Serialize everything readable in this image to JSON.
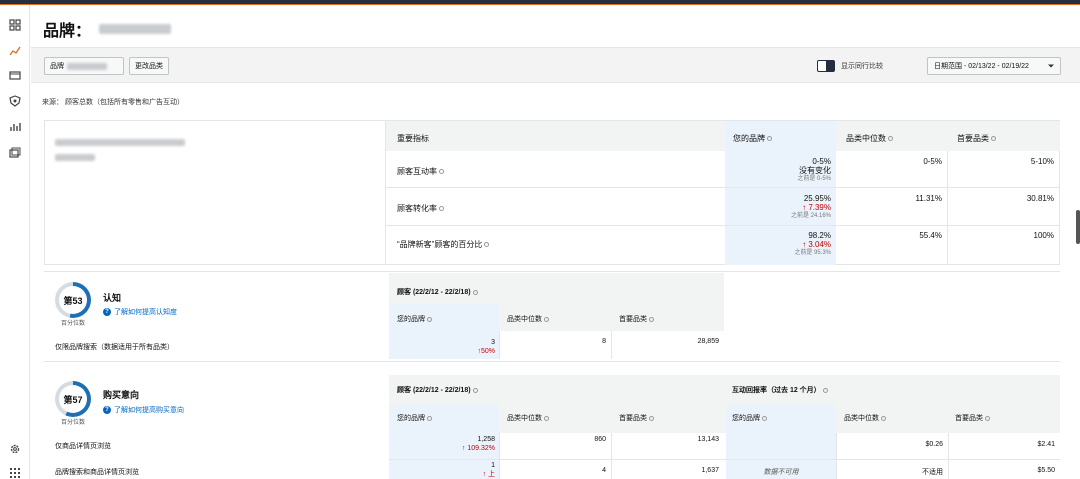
{
  "header": {
    "title": "品牌："
  },
  "toolbar": {
    "brand_button": "品牌",
    "change_category_button": "更改品类",
    "compare_toggle_label": "显示同行比较",
    "date_range": "日期范围 - 02/13/22 - 02/19/22"
  },
  "source": "来源： 顾客总数（包括所有零售和广告互动）",
  "metrics_table": {
    "headers": [
      "重要指标",
      "您的品牌",
      "品类中位数",
      "首要品类"
    ],
    "rows": [
      {
        "label": "顾客互动率",
        "brand_value": "0-5%",
        "brand_change": "没有变化",
        "brand_prev": "之前是 0-5%",
        "median": "0-5%",
        "top": "5-10%"
      },
      {
        "label": "顾客转化率",
        "brand_value": "25.95%",
        "brand_change": "7.39%",
        "brand_prev": "之前是 24.16%",
        "median": "11.31%",
        "top": "30.81%"
      },
      {
        "label": "“品牌新客”顾客的百分比",
        "brand_value": "98.2%",
        "brand_change": "3.04%",
        "brand_prev": "之前是 95.3%",
        "median": "55.4%",
        "top": "100%"
      }
    ]
  },
  "awareness": {
    "rank": "第53",
    "rank_sub": "百分位数",
    "title": "认知",
    "help_link": "了解如何提高认知度",
    "section_header": "顾客 (22/2/12 - 22/2/18)",
    "col_headers": [
      "您的品牌",
      "品类中位数",
      "首要品类"
    ],
    "row_label": "仅限品牌搜索（数据适用于所有品类）",
    "brand_value": "3",
    "brand_change": "50%",
    "median": "8",
    "top": "28,859"
  },
  "intent": {
    "rank": "第57",
    "rank_sub": "百分位数",
    "title": "购买意向",
    "help_link": "了解如何提高购买意向",
    "section_header": "顾客 (22/2/12 - 22/2/18)",
    "section_header_2": "互动回报率（过去 12 个月）",
    "col_headers": [
      "您的品牌",
      "品类中位数",
      "首要品类",
      "您的品牌",
      "品类中位数",
      "首要品类"
    ],
    "rows": [
      {
        "label": "仅商品详情页浏览",
        "brand_value": "1,258",
        "brand_change": "109.32%",
        "median": "860",
        "top": "13,143",
        "roi_brand": "",
        "roi_median": "$0.26",
        "roi_top": "$2.41"
      },
      {
        "label": "品牌搜索和商品详情页浏览",
        "brand_value": "1",
        "brand_change": "上",
        "median": "4",
        "top": "1,637",
        "roi_brand": "数据不可用",
        "roi_median": "不适用",
        "roi_top": "$5.50"
      }
    ]
  },
  "colors": {
    "accent": "#0066c0",
    "up": "#c40000",
    "highlight": "#eaf3fb",
    "navy": "#232f3e"
  }
}
